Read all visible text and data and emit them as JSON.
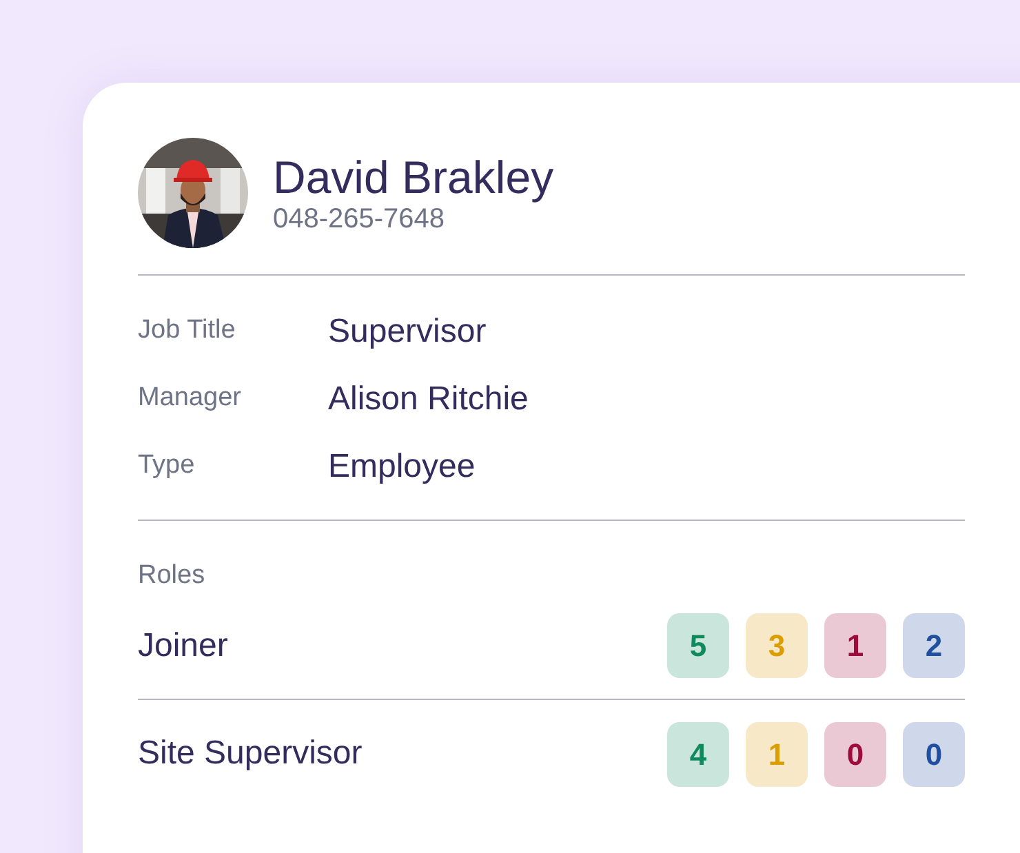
{
  "profile": {
    "name": "David Brakley",
    "phone": "048-265-7648"
  },
  "details": [
    {
      "label": "Job Title",
      "value": "Supervisor"
    },
    {
      "label": "Manager",
      "value": "Alison Ritchie"
    },
    {
      "label": "Type",
      "value": "Employee"
    }
  ],
  "roles": {
    "heading": "Roles",
    "items": [
      {
        "name": "Joiner",
        "counts": [
          {
            "value": "5",
            "color": "#0f8a5f"
          },
          {
            "value": "3",
            "color": "#dc9d00"
          },
          {
            "value": "1",
            "color": "#9e0b3d"
          },
          {
            "value": "2",
            "color": "#1f4f9e"
          }
        ]
      },
      {
        "name": "Site Supervisor",
        "counts": [
          {
            "value": "4",
            "color": "#0f8a5f"
          },
          {
            "value": "1",
            "color": "#dc9d00"
          },
          {
            "value": "0",
            "color": "#9e0b3d"
          },
          {
            "value": "0",
            "color": "#1f4f9e"
          }
        ]
      }
    ]
  }
}
